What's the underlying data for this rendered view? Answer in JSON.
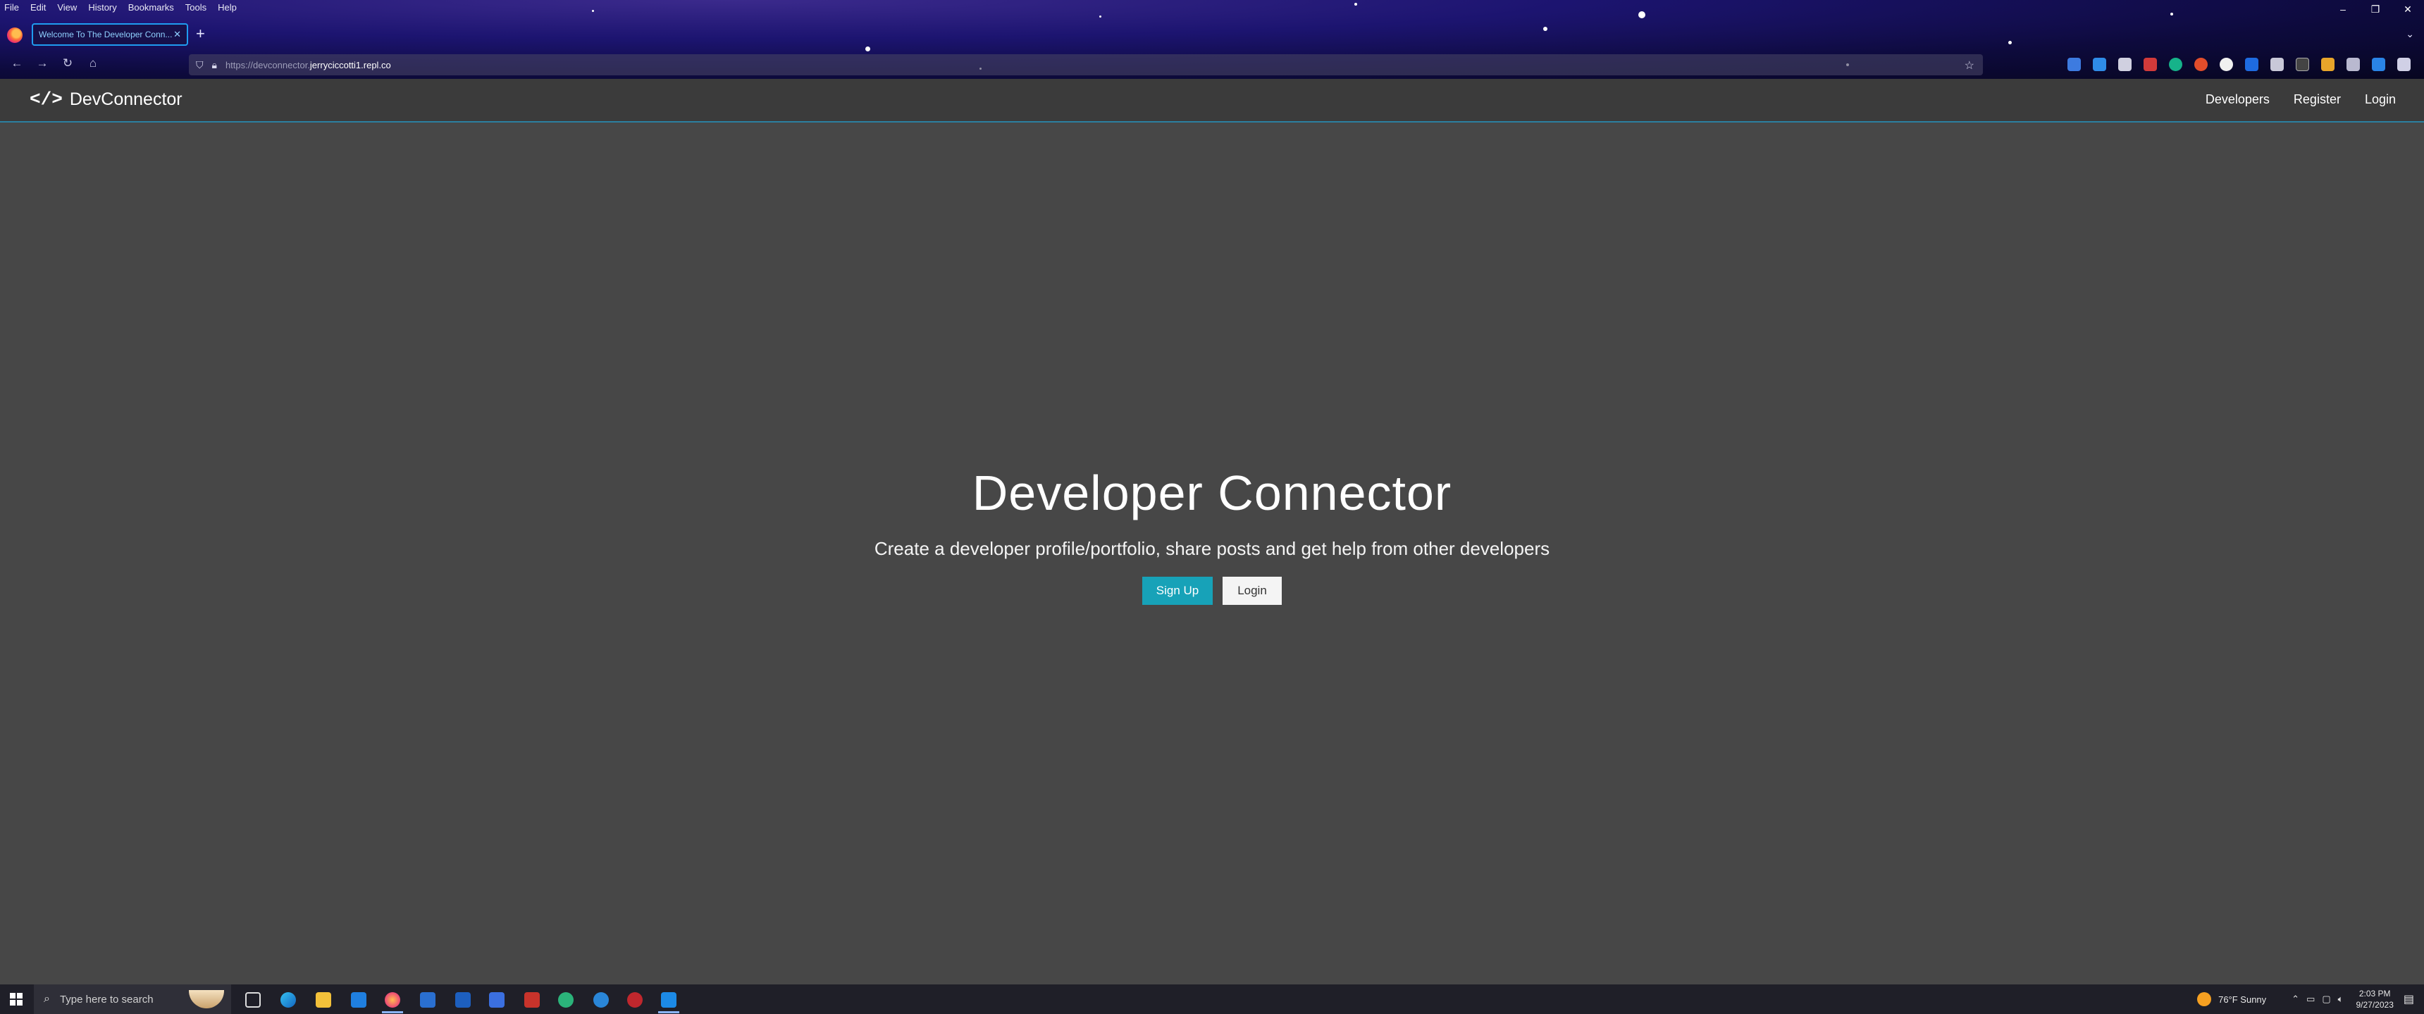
{
  "browser": {
    "menu": [
      "File",
      "Edit",
      "View",
      "History",
      "Bookmarks",
      "Tools",
      "Help"
    ],
    "tab_title": "Welcome To The Developer Conn...",
    "url_prefix": "https://devconnector.",
    "url_host": "jerryciccotti1.repl.co",
    "window_controls": {
      "minimize": "–",
      "restore": "❐",
      "close": "✕"
    }
  },
  "app": {
    "brand": {
      "icon": "</>",
      "name": "DevConnector"
    },
    "nav": [
      "Developers",
      "Register",
      "Login"
    ],
    "hero": {
      "title": "Developer Connector",
      "subtitle": "Create a developer profile/portfolio, share posts and get help from other developers",
      "signup_label": "Sign Up",
      "login_label": "Login"
    }
  },
  "taskbar": {
    "search_placeholder": "Type here to search",
    "weather": "76°F  Sunny",
    "time": "2:03 PM",
    "date": "9/27/2023"
  },
  "colors": {
    "page_bg": "#474747",
    "navbar_bg": "#3b3b3b",
    "primary": "#17a2b8",
    "light": "#f4f4f4"
  }
}
